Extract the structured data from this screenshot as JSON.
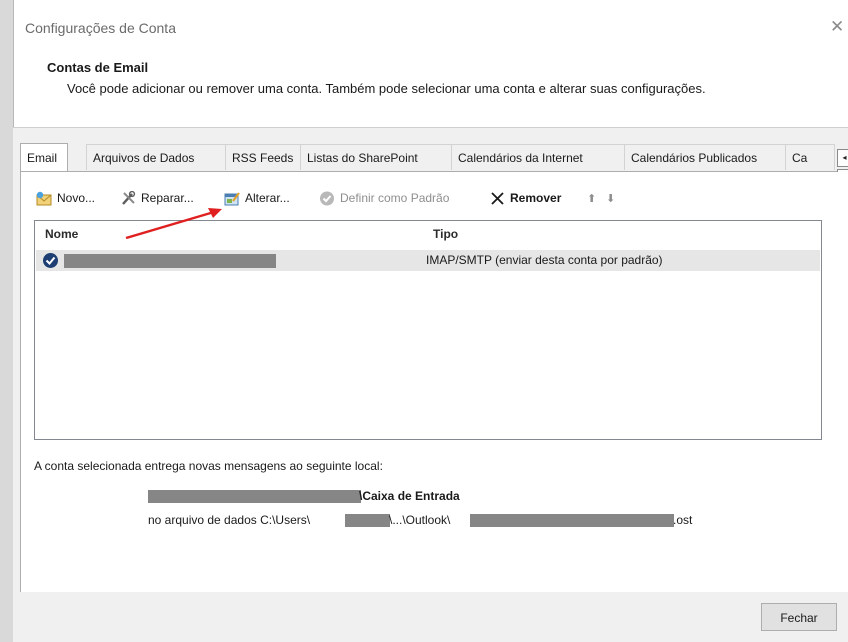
{
  "window": {
    "title": "Configurações de Conta",
    "close_glyph": "✕"
  },
  "header": {
    "heading": "Contas de Email",
    "description": "Você pode adicionar ou remover uma conta. Também pode selecionar uma conta e alterar suas configurações."
  },
  "tabs": [
    "Email",
    "Arquivos de Dados",
    "RSS Feeds",
    "Listas do SharePoint",
    "Calendários da Internet",
    "Calendários Publicados",
    "Ca"
  ],
  "tab_scroll": {
    "left": "◂",
    "right": "▸"
  },
  "toolbar": {
    "new_label": "Novo...",
    "repair_label": "Reparar...",
    "change_label": "Alterar...",
    "set_default_label": "Definir como Padrão",
    "remove_label": "Remover",
    "up_glyph": "⬆",
    "down_glyph": "⬇"
  },
  "list": {
    "columns": {
      "name": "Nome",
      "type": "Tipo"
    },
    "rows": [
      {
        "type": "IMAP/SMTP (enviar desta conta por padrão)",
        "is_default": true
      }
    ]
  },
  "delivery": {
    "intro": "A conta selecionada entrega novas mensagens ao seguinte local:",
    "folder_suffix": "\\Caixa de Entrada",
    "file_prefix": "no arquivo de dados C:\\Users\\",
    "file_middle": "\\...\\Outlook\\",
    "file_suffix": ".ost"
  },
  "footer": {
    "close_label": "Fechar"
  },
  "colors": {
    "accent": "#1e4f8f",
    "annotation_arrow": "#e02020",
    "redaction": "#868686"
  }
}
